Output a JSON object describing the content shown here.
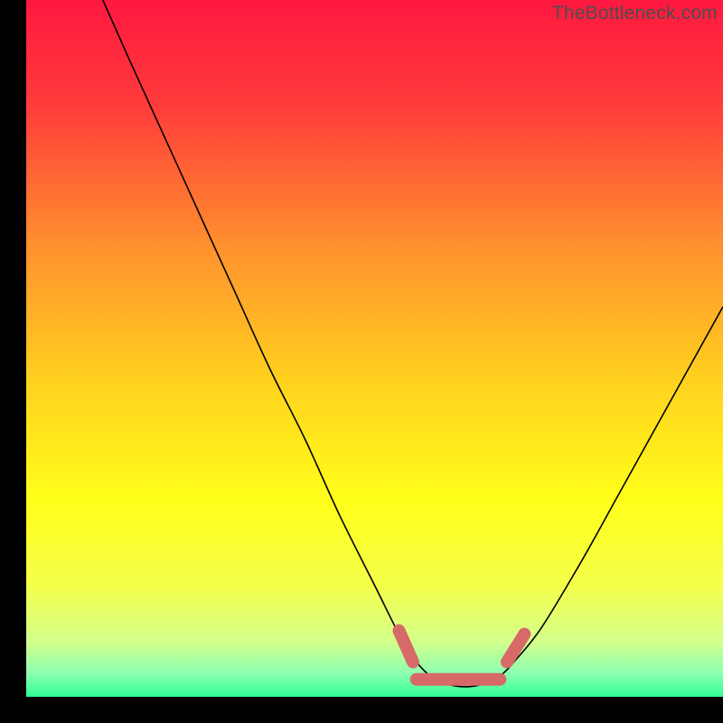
{
  "watermark": "TheBottleneck.com",
  "chart_data": {
    "type": "line",
    "title": "",
    "xlabel": "",
    "ylabel": "",
    "xlim": [
      0,
      100
    ],
    "ylim": [
      0,
      100
    ],
    "series": [
      {
        "name": "bottleneck-curve",
        "x": [
          11,
          15,
          20,
          25,
          30,
          35,
          40,
          45,
          50,
          54,
          56,
          58,
          60,
          62,
          64,
          66,
          68,
          70,
          74,
          80,
          85,
          90,
          95,
          100
        ],
        "y": [
          100,
          91,
          80,
          69,
          58,
          47,
          37,
          26,
          16,
          8,
          5,
          3,
          2,
          1.5,
          1.5,
          2,
          3,
          5,
          10,
          20,
          29,
          38,
          47,
          56
        ]
      },
      {
        "name": "optimal-zone-left",
        "x": [
          53.5,
          55.5
        ],
        "y": [
          9.5,
          5.0
        ]
      },
      {
        "name": "optimal-zone-bottom",
        "x": [
          56,
          68
        ],
        "y": [
          2.5,
          2.5
        ]
      },
      {
        "name": "optimal-zone-right",
        "x": [
          69,
          71.5
        ],
        "y": [
          5.0,
          9.0
        ]
      }
    ],
    "gradient_stops": [
      {
        "offset": 0.0,
        "color": "#ff183f"
      },
      {
        "offset": 0.15,
        "color": "#ff3b3b"
      },
      {
        "offset": 0.35,
        "color": "#ff8f2e"
      },
      {
        "offset": 0.55,
        "color": "#ffd21e"
      },
      {
        "offset": 0.72,
        "color": "#ffff1a"
      },
      {
        "offset": 0.84,
        "color": "#f4ff4a"
      },
      {
        "offset": 0.92,
        "color": "#d4ff8a"
      },
      {
        "offset": 0.965,
        "color": "#8fffb0"
      },
      {
        "offset": 1.0,
        "color": "#2fff94"
      }
    ],
    "colors": {
      "curve": "#000000",
      "optimal": "#d76a68",
      "background": "#000000"
    }
  }
}
